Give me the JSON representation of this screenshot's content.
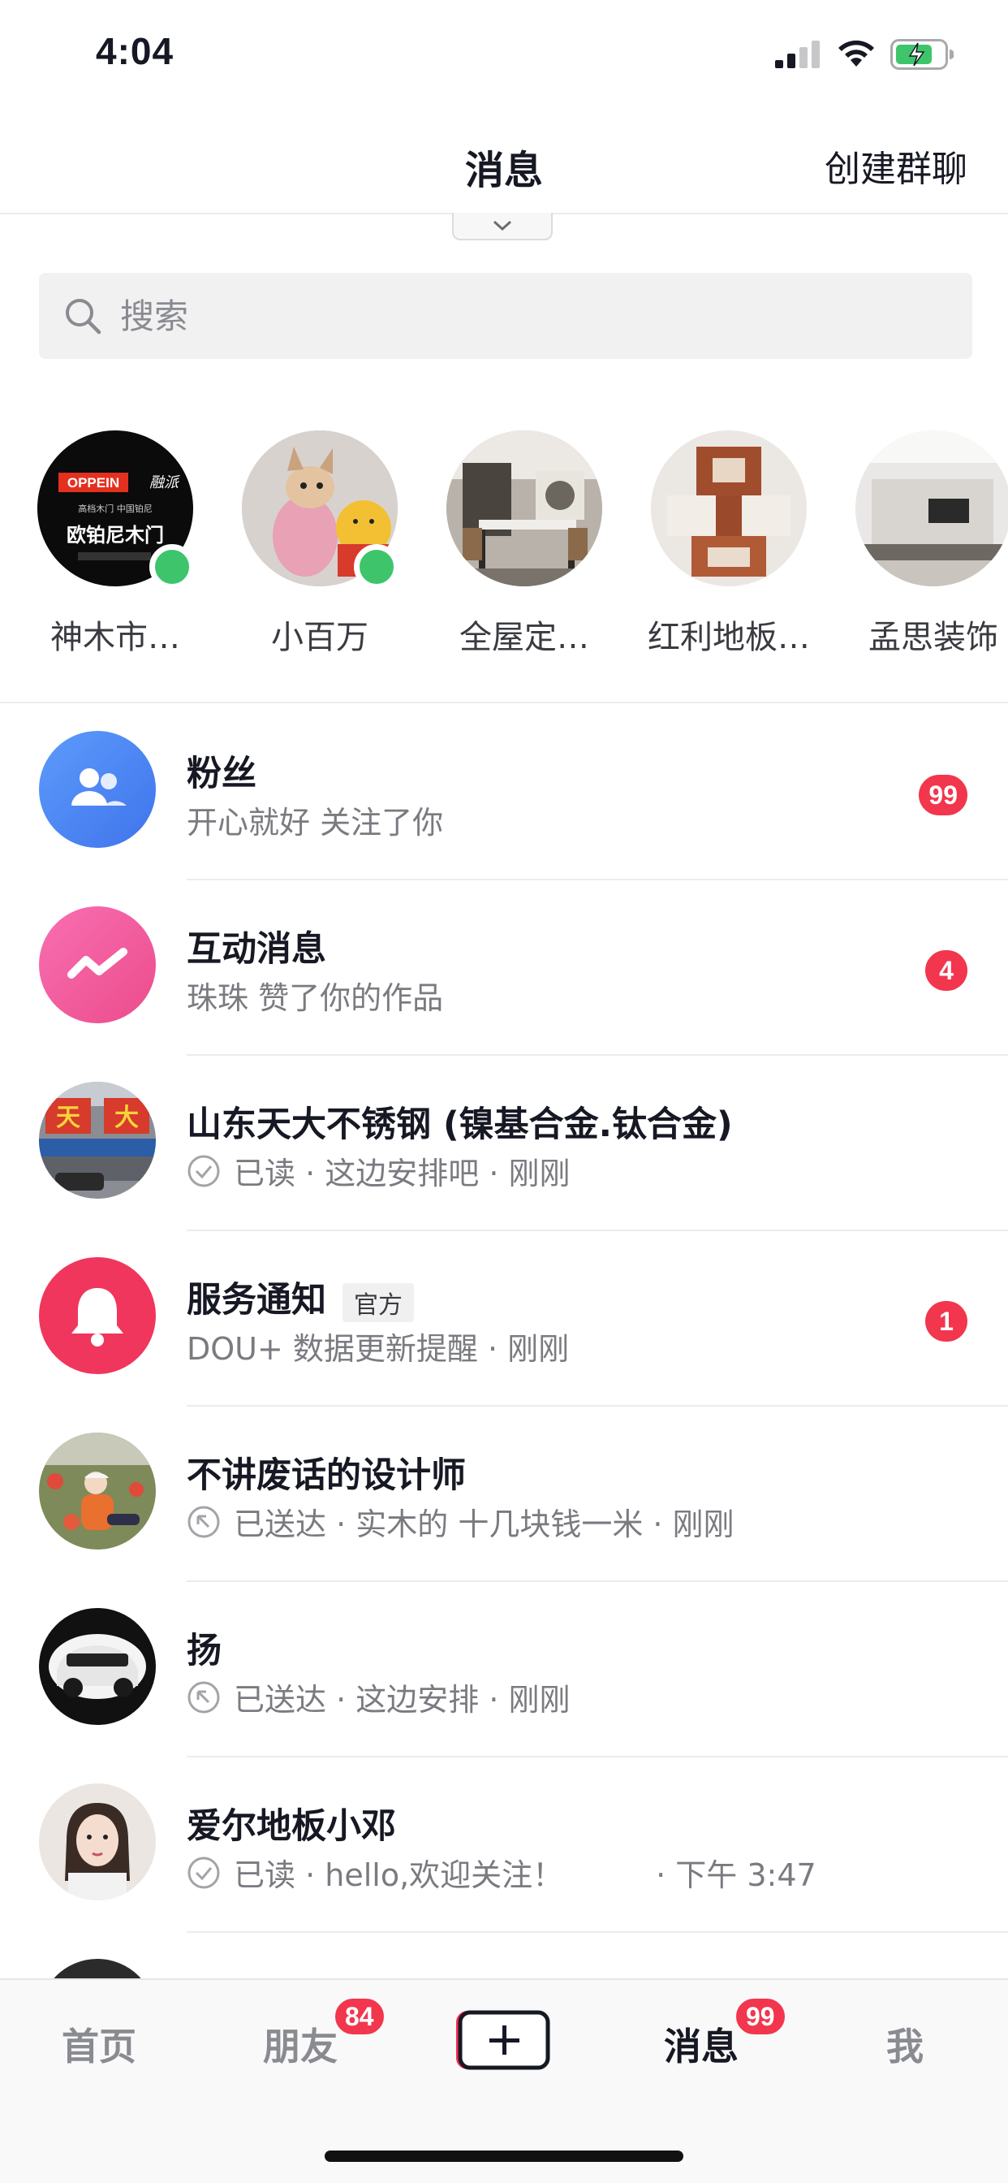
{
  "status_bar": {
    "time": "4:04"
  },
  "header": {
    "title": "消息",
    "create_group_label": "创建群聊"
  },
  "search": {
    "placeholder": "搜索"
  },
  "stories": [
    {
      "name": "神木市…",
      "online": true,
      "logo_top": "OPPEIN",
      "logo_main": "欧铂尼木门"
    },
    {
      "name": "小百万",
      "online": true
    },
    {
      "name": "全屋定…",
      "online": false
    },
    {
      "name": "红利地板…",
      "online": false
    },
    {
      "name": "孟思装饰",
      "online": false
    }
  ],
  "conversations": [
    {
      "title": "粉丝",
      "subtitle": "开心就好 关注了你",
      "badge": "99",
      "avatar_icon": "fans-icon",
      "avatar_color": "#4f86f7"
    },
    {
      "title": "互动消息",
      "subtitle": "珠珠 赞了你的作品",
      "badge": "4",
      "avatar_icon": "interaction-icon",
      "avatar_color": "#f25a9e"
    },
    {
      "title": "山东天大不锈钢 (镍基合金.钛合金)",
      "subtitle": "已读 · 这边安排吧 · 刚刚",
      "status": "read",
      "avatar_text": "天大"
    },
    {
      "title": "服务通知",
      "tag": "官方",
      "subtitle": "DOU+ 数据更新提醒 · 刚刚",
      "badge": "1",
      "avatar_icon": "bell-icon",
      "avatar_color": "#f2365d"
    },
    {
      "title": "不讲废话的设计师",
      "subtitle": "已送达 · 实木的 十几块钱一米 · 刚刚",
      "status": "sent"
    },
    {
      "title": "扬",
      "subtitle": "已送达 · 这边安排 · 刚刚",
      "status": "sent"
    },
    {
      "title": "爱尔地板小邓",
      "subtitle": "已读 · hello,欢迎关注！　　　· 下午 3:47",
      "status": "read"
    }
  ],
  "tab_bar": {
    "tabs": [
      {
        "label": "首页"
      },
      {
        "label": "朋友",
        "badge": "84"
      },
      {
        "label": "消息",
        "badge": "99",
        "active": true
      },
      {
        "label": "我"
      }
    ]
  },
  "colors": {
    "badge": "#f2364d",
    "online": "#3ec56b",
    "text_primary": "#161823",
    "text_secondary": "#7a7b80"
  }
}
